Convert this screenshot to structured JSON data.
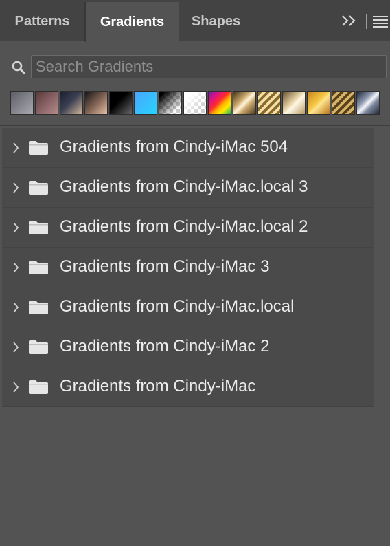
{
  "tabs": [
    {
      "label": "Patterns",
      "active": false
    },
    {
      "label": "Gradients",
      "active": true
    },
    {
      "label": "Shapes",
      "active": false
    }
  ],
  "header_actions": {
    "expand_icon": "double-chevron-right-icon",
    "menu_icon": "hamburger-menu-icon"
  },
  "search": {
    "placeholder": "Search Gradients",
    "value": ""
  },
  "swatches": [
    {
      "name": "gray-gradient",
      "css": "linear-gradient(135deg,#5e5e66,#a9a9b2)"
    },
    {
      "name": "rose-gradient",
      "css": "linear-gradient(135deg,#5a3a3c,#b58a8c)"
    },
    {
      "name": "navy-tan-gradient",
      "css": "linear-gradient(135deg,#1d2030,#3a3f52 45%,#d2b59a)"
    },
    {
      "name": "black-copper-gradient",
      "css": "linear-gradient(135deg,#181818,#8a6a5a 55%,#e6c2a6)"
    },
    {
      "name": "black-white-gradient",
      "css": "linear-gradient(135deg,#000000,#000 40%,#666 100%)"
    },
    {
      "name": "cyan-blue-gradient",
      "css": "linear-gradient(135deg,#4aa6ff,#27d4ff)"
    },
    {
      "name": "black-transparent-gradient",
      "css": "linear-gradient(135deg,#000 10%,rgba(0,0,0,0) 80%), repeating-conic-gradient(#ffffff 0% 25%,#c8c8c8 0% 50%) 0 0/10px 10px"
    },
    {
      "name": "white-transparent-gradient",
      "css": "linear-gradient(135deg,#ffffff 20%,rgba(255,255,255,0) 80%), repeating-conic-gradient(#ffffff 0% 25%,#cdcdcd 0% 50%) 0 0/10px 10px"
    },
    {
      "name": "spectrum-gradient",
      "css": "linear-gradient(135deg,#7a1fb6,#e3127a 25%,#ff2d2d 45%,#ffb300 60%,#ffea00 75%,#18b45a)"
    },
    {
      "name": "gold-stripe-gradient",
      "css": "linear-gradient(135deg,#4a3a1c,#c9a56a 35%,#fff4d8 50%,#c9a56a 65%,#4a3a1c)"
    },
    {
      "name": "gold-stripes-gradient",
      "css": "repeating-linear-gradient(135deg,#8a6a2a 0 4px,#f3dfa8 4px 8px)"
    },
    {
      "name": "champagne-gradient",
      "css": "linear-gradient(135deg,#6b5534,#e9d6a9 45%,#fff8e8 55%,#b79a64)"
    },
    {
      "name": "gold-gradient",
      "css": "linear-gradient(135deg,#c8871e,#f7c945 45%,#ffe58f 55%,#b8741a)"
    },
    {
      "name": "brass-stripes-gradient",
      "css": "repeating-linear-gradient(135deg,#5a4218 0 4px,#d6b26a 4px 8px)"
    },
    {
      "name": "silver-gradient",
      "css": "linear-gradient(135deg,#222a3a,#8f9ab0 35%,#f4f6fb 50%,#7d879e 65%,#222a3a)"
    }
  ],
  "folders": [
    {
      "label": "Gradients from Cindy-iMac 504"
    },
    {
      "label": "Gradients from Cindy-iMac.local 3"
    },
    {
      "label": "Gradients from Cindy-iMac.local 2"
    },
    {
      "label": "Gradients from Cindy-iMac 3"
    },
    {
      "label": "Gradients from Cindy-iMac.local"
    },
    {
      "label": "Gradients from Cindy-iMac 2"
    },
    {
      "label": "Gradients from Cindy-iMac"
    }
  ],
  "colors": {
    "panel_bg": "#535353",
    "tabbar_bg": "#434343",
    "row_bg": "#4a4a4a",
    "text": "#ececec"
  }
}
